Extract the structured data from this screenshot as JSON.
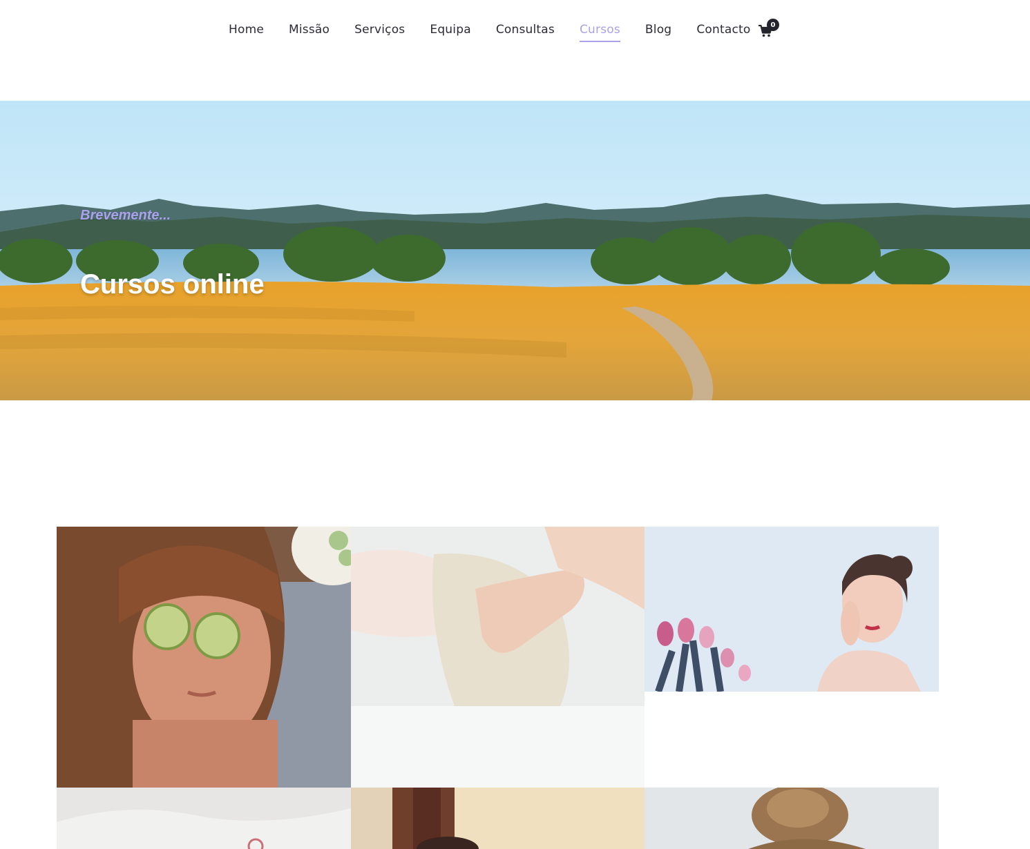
{
  "nav": {
    "items": [
      {
        "label": "Home",
        "active": false
      },
      {
        "label": "Missão",
        "active": false
      },
      {
        "label": "Serviços",
        "active": false
      },
      {
        "label": "Equipa",
        "active": false
      },
      {
        "label": "Consultas",
        "active": false
      },
      {
        "label": "Cursos",
        "active": true
      },
      {
        "label": "Blog",
        "active": false
      },
      {
        "label": "Contacto",
        "active": false
      }
    ],
    "cart_count": "0",
    "cart_icon": "shopping-cart-icon",
    "accent_color": "#a8a2e6"
  },
  "hero": {
    "eyebrow": "Brevemente...",
    "title": "Cursos online"
  },
  "gallery": {
    "tiles": [
      {
        "subject": "woman-cucumber-eyes"
      },
      {
        "subject": "head-massage"
      },
      {
        "subject": "woman-with-tulips"
      },
      {
        "subject": "spa-towel"
      },
      {
        "subject": "facial-treatment"
      },
      {
        "subject": "hair-bun"
      }
    ]
  }
}
